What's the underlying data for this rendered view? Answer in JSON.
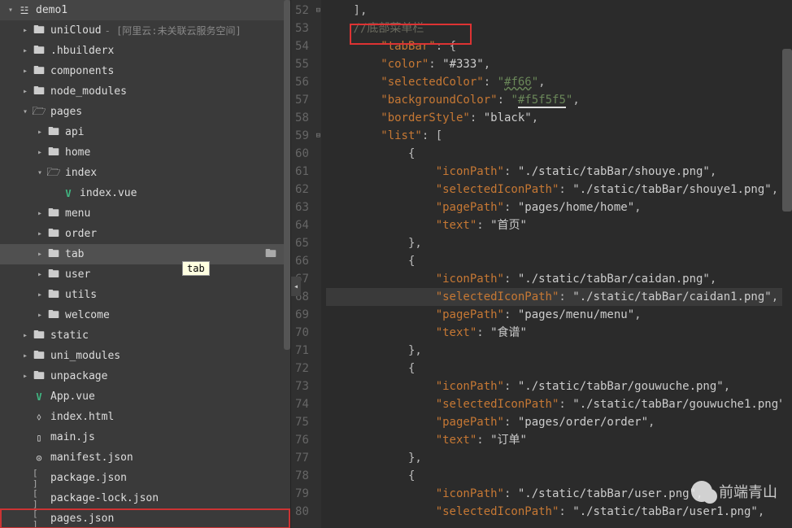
{
  "sidebar": {
    "project_name": "demo1",
    "uni_cloud": {
      "label": "uniCloud",
      "note": "- [阿里云:未关联云服务空间]"
    },
    "items": [
      {
        "label": ".hbuilderx"
      },
      {
        "label": "components"
      },
      {
        "label": "node_modules"
      },
      {
        "label": "pages"
      },
      {
        "label": "api"
      },
      {
        "label": "home"
      },
      {
        "label": "index"
      },
      {
        "label": "index.vue"
      },
      {
        "label": "menu"
      },
      {
        "label": "order"
      },
      {
        "label": "tab"
      },
      {
        "label": "user"
      },
      {
        "label": "utils"
      },
      {
        "label": "welcome"
      },
      {
        "label": "static"
      },
      {
        "label": "uni_modules"
      },
      {
        "label": "unpackage"
      },
      {
        "label": "App.vue"
      },
      {
        "label": "index.html"
      },
      {
        "label": "main.js"
      },
      {
        "label": "manifest.json"
      },
      {
        "label": "package.json"
      },
      {
        "label": "package-lock.json"
      },
      {
        "label": "pages.json"
      }
    ],
    "tooltip": "tab"
  },
  "editor": {
    "line_start": 52,
    "comment": "//底部菜单栏",
    "lines": [
      {
        "n": 52,
        "t": "    ],"
      },
      {
        "n": 53,
        "t": ""
      },
      {
        "n": 54,
        "t": "        \"tabBar\": {"
      },
      {
        "n": 55,
        "t": "        \"color\": \"#333\","
      },
      {
        "n": 56,
        "t": "        \"selectedColor\": \"#f66\","
      },
      {
        "n": 57,
        "t": "        \"backgroundColor\": \"#f5f5f5\","
      },
      {
        "n": 58,
        "t": "        \"borderStyle\": \"black\","
      },
      {
        "n": 59,
        "t": "        \"list\": ["
      },
      {
        "n": 60,
        "t": "            {"
      },
      {
        "n": 61,
        "t": "                \"iconPath\": \"./static/tabBar/shouye.png\","
      },
      {
        "n": 62,
        "t": "                \"selectedIconPath\": \"./static/tabBar/shouye1.png\","
      },
      {
        "n": 63,
        "t": "                \"pagePath\": \"pages/home/home\","
      },
      {
        "n": 64,
        "t": "                \"text\": \"首页\""
      },
      {
        "n": 65,
        "t": "            },"
      },
      {
        "n": 66,
        "t": "            {"
      },
      {
        "n": 67,
        "t": "                \"iconPath\": \"./static/tabBar/caidan.png\","
      },
      {
        "n": 68,
        "t": "                \"selectedIconPath\": \"./static/tabBar/caidan1.png\","
      },
      {
        "n": 69,
        "t": "                \"pagePath\": \"pages/menu/menu\","
      },
      {
        "n": 70,
        "t": "                \"text\": \"食谱\""
      },
      {
        "n": 71,
        "t": "            },"
      },
      {
        "n": 72,
        "t": "            {"
      },
      {
        "n": 73,
        "t": "                \"iconPath\": \"./static/tabBar/gouwuche.png\","
      },
      {
        "n": 74,
        "t": "                \"selectedIconPath\": \"./static/tabBar/gouwuche1.png\","
      },
      {
        "n": 75,
        "t": "                \"pagePath\": \"pages/order/order\","
      },
      {
        "n": 76,
        "t": "                \"text\": \"订单\""
      },
      {
        "n": 77,
        "t": "            },"
      },
      {
        "n": 78,
        "t": "            {"
      },
      {
        "n": 79,
        "t": "                \"iconPath\": \"./static/tabBar/user.png\","
      },
      {
        "n": 80,
        "t": "                \"selectedIconPath\": \"./static/tabBar/user1.png\","
      }
    ]
  },
  "watermark": "前端青山"
}
